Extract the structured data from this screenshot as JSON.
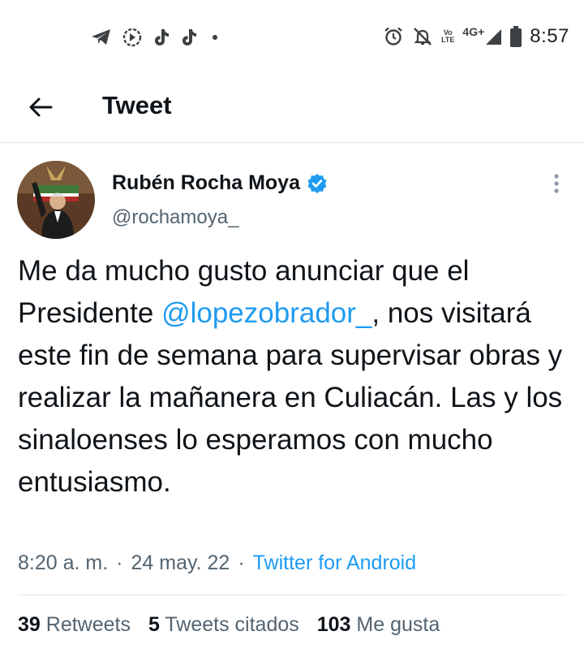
{
  "status_bar": {
    "time": "8:57",
    "network": "4G+",
    "volte_top": "Vo",
    "volte_bottom": "LTE",
    "left_icons": [
      "telegram-icon",
      "signal-messenger-icon",
      "tiktok-icon",
      "tiktok-icon"
    ],
    "right_icons": [
      "alarm-icon",
      "silent-bell-icon",
      "volte-icon",
      "signal-strength-icon",
      "battery-icon"
    ]
  },
  "header": {
    "title": "Tweet"
  },
  "tweet": {
    "author_name": "Rubén Rocha Moya",
    "author_handle": "@rochamoya_",
    "text_before_mention": "Me da mucho gusto anunciar que el Presidente ",
    "mention": "@lopezobrador_",
    "text_after_mention": ", nos visitará este fin de semana para supervisar obras y realizar la mañanera en Culiacán. Las y los sinaloenses lo esperamos con mucho entusiasmo.",
    "time": "8:20 a. m.",
    "separator": "·",
    "date": "24 may. 22",
    "source": "Twitter for Android"
  },
  "stats": {
    "retweets_count": "39",
    "retweets_label": "Retweets",
    "quotes_count": "5",
    "quotes_label": "Tweets citados",
    "likes_count": "103",
    "likes_label": "Me gusta"
  },
  "colors": {
    "accent": "#1d9bf0",
    "text_primary": "#0f1419",
    "text_secondary": "#536471",
    "divider": "#e1e4e6"
  }
}
